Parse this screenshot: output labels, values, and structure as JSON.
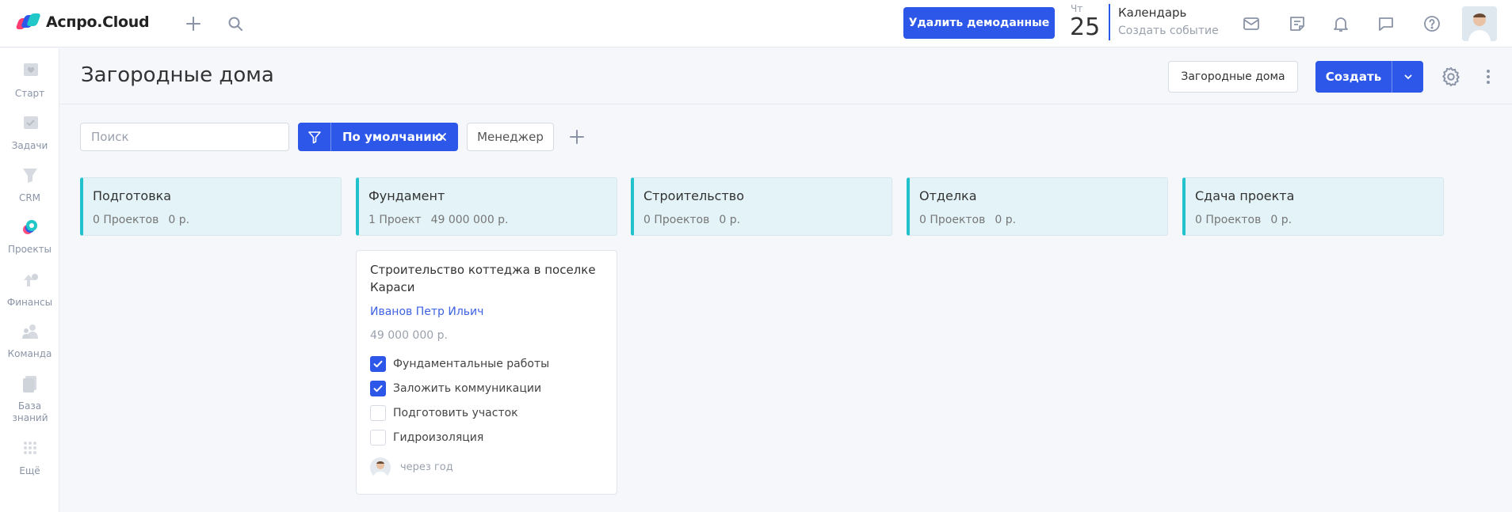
{
  "app": {
    "name": "Аспро.Cloud"
  },
  "topbar": {
    "demo_button": "Удалить демоданные",
    "date": {
      "dow": "Чт",
      "day": "25"
    },
    "calendar": {
      "title": "Календарь",
      "subtitle": "Создать событие"
    }
  },
  "sidebar": {
    "items": [
      {
        "label": "Старт",
        "icon": "heart-icon"
      },
      {
        "label": "Задачи",
        "icon": "tasks-icon"
      },
      {
        "label": "CRM",
        "icon": "funnel-icon"
      },
      {
        "label": "Проекты",
        "icon": "projects-icon",
        "active": true
      },
      {
        "label": "Финансы",
        "icon": "finance-icon"
      },
      {
        "label": "Команда",
        "icon": "team-icon"
      },
      {
        "label": "База знаний",
        "icon": "knowledge-icon"
      },
      {
        "label": "Ещё",
        "icon": "more-grid-icon"
      }
    ]
  },
  "page": {
    "title": "Загородные дома",
    "view_button": "Загородные дома",
    "create_button": "Создать"
  },
  "filters": {
    "search_placeholder": "Поиск",
    "active_filter": "По умолчанию",
    "manager": "Менеджер"
  },
  "columns": [
    {
      "title": "Подготовка",
      "count": "0 Проектов",
      "sum": "0 р."
    },
    {
      "title": "Фундамент",
      "count": "1 Проект",
      "sum": "49 000 000 р."
    },
    {
      "title": "Строительство",
      "count": "0 Проектов",
      "sum": "0 р."
    },
    {
      "title": "Отделка",
      "count": "0 Проектов",
      "sum": "0 р."
    },
    {
      "title": "Сдача проекта",
      "count": "0 Проектов",
      "sum": "0 р."
    }
  ],
  "card": {
    "title": "Строительство коттеджа в поселке Караси",
    "manager": "Иванов Петр Ильич",
    "sum": "49 000 000 р.",
    "tasks": [
      {
        "label": "Фундаментальные работы",
        "done": true
      },
      {
        "label": "Заложить коммуникации",
        "done": true
      },
      {
        "label": "Подготовить участок",
        "done": false
      },
      {
        "label": "Гидроизоляция",
        "done": false
      }
    ],
    "deadline": "через год"
  },
  "colors": {
    "accent": "#2d57e8",
    "column_accent": "#22c2cc",
    "column_bg": "#e3f3f7"
  }
}
